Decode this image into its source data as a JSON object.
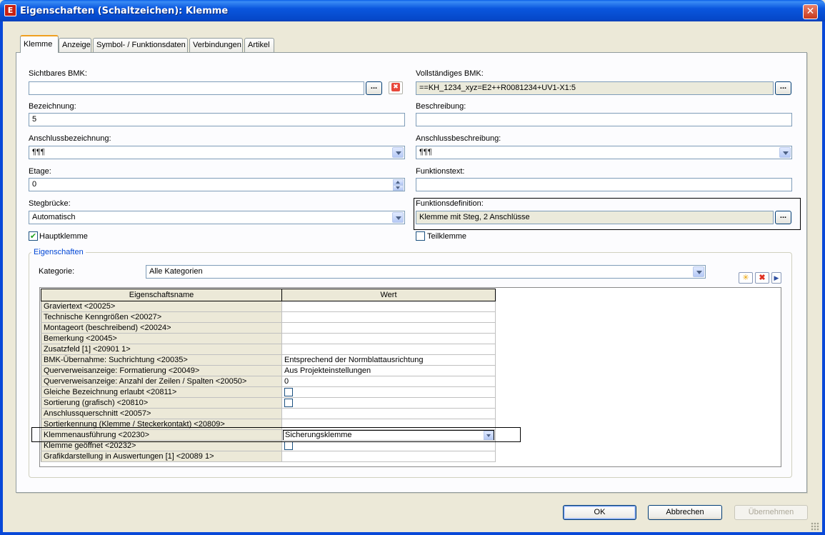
{
  "window": {
    "title": "Eigenschaften (Schaltzeichen): Klemme",
    "close_glyph": "✕",
    "icon_glyph": "E"
  },
  "tabs": [
    {
      "label": "Klemme",
      "active": true
    },
    {
      "label": "Anzeige"
    },
    {
      "label": "Symbol- / Funktionsdaten"
    },
    {
      "label": "Verbindungen"
    },
    {
      "label": "Artikel"
    }
  ],
  "form": {
    "sichtbares_bmk": {
      "label": "Sichtbares BMK:",
      "value": ""
    },
    "vollstaendiges_bmk": {
      "label": "Vollständiges BMK:",
      "value": "==KH_1234_xyz=E2++R0081234+UV1-X1:5"
    },
    "bezeichnung": {
      "label": "Bezeichnung:",
      "value": "5"
    },
    "beschreibung": {
      "label": "Beschreibung:",
      "value": ""
    },
    "anschlussbezeichnung": {
      "label": "Anschlussbezeichnung:",
      "value": "¶¶¶"
    },
    "anschlussbeschreibung": {
      "label": "Anschlussbeschreibung:",
      "value": "¶¶¶"
    },
    "etage": {
      "label": "Etage:",
      "value": "0"
    },
    "funktionstext": {
      "label": "Funktionstext:",
      "value": ""
    },
    "stegbruecke": {
      "label": "Stegbrücke:",
      "value": "Automatisch"
    },
    "funktionsdefinition": {
      "label": "Funktionsdefinition:",
      "value": "Klemme mit Steg, 2 Anschlüsse"
    },
    "hauptklemme": {
      "label": "Hauptklemme",
      "checked": true
    },
    "teilklemme": {
      "label": "Teilklemme",
      "checked": false
    },
    "dots_label": "..."
  },
  "eigenschaften": {
    "group_title": "Eigenschaften",
    "kategorie_label": "Kategorie:",
    "kategorie_value": "Alle Kategorien",
    "tool_icons": [
      "new-star-icon",
      "delete-x-icon",
      "arrow-right-icon"
    ],
    "columns": [
      "Eigenschaftsname",
      "Wert"
    ],
    "rows": [
      {
        "name": "Graviertext <20025>",
        "value": ""
      },
      {
        "name": "Technische Kenngrößen <20027>",
        "value": ""
      },
      {
        "name": "Montageort (beschreibend) <20024>",
        "value": ""
      },
      {
        "name": "Bemerkung <20045>",
        "value": ""
      },
      {
        "name": "Zusatzfeld [1] <20901 1>",
        "value": ""
      },
      {
        "name": "BMK-Übernahme: Suchrichtung <20035>",
        "value": "Entsprechend der Normblattausrichtung"
      },
      {
        "name": "Querverweisanzeige: Formatierung <20049>",
        "value": "Aus Projekteinstellungen"
      },
      {
        "name": "Querverweisanzeige: Anzahl der Zeilen / Spalten <20050>",
        "value": "0"
      },
      {
        "name": "Gleiche Bezeichnung erlaubt <20811>",
        "checkbox": true
      },
      {
        "name": "Sortierung (grafisch) <20810>",
        "checkbox": true
      },
      {
        "name": "Anschlussquerschnitt <20057>",
        "value": ""
      },
      {
        "name": "Sortierkennung (Klemme / Steckerkontakt) <20809>",
        "value": ""
      },
      {
        "name": "Klemmenausführung <20230>",
        "value": "Sicherungsklemme",
        "combo": true
      },
      {
        "name": "Klemme geöffnet <20232>",
        "checkbox": true
      },
      {
        "name": "Grafikdarstellung in Auswertungen [1] <20089 1>",
        "value": ""
      }
    ]
  },
  "buttons": {
    "ok": "OK",
    "abbrechen": "Abbrechen",
    "uebernehmen": "Übernehmen"
  }
}
